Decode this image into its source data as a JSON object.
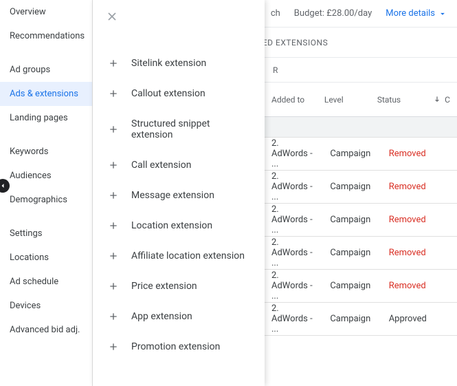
{
  "sidebar": {
    "items": [
      {
        "label": "Overview"
      },
      {
        "label": "Recommendations"
      },
      {
        "label": "Ad groups"
      },
      {
        "label": "Ads & extensions"
      },
      {
        "label": "Landing pages"
      },
      {
        "label": "Keywords"
      },
      {
        "label": "Audiences"
      },
      {
        "label": "Demographics"
      },
      {
        "label": "Settings"
      },
      {
        "label": "Locations"
      },
      {
        "label": "Ad schedule"
      },
      {
        "label": "Devices"
      },
      {
        "label": "Advanced bid adj."
      }
    ]
  },
  "topbar": {
    "search_fragment": "ch",
    "budget_label": "Budget: £28.00/day",
    "more_details": "More details"
  },
  "tabs": {
    "automated": "AUTOMATED EXTENSIONS"
  },
  "table": {
    "filter_fragment": "R",
    "headers": {
      "added_to": "Added to",
      "level": "Level",
      "status": "Status",
      "last": "C"
    },
    "rows": [
      {
        "added_to": "2. AdWords - ...",
        "level": "Campaign",
        "status": "Removed"
      },
      {
        "added_to": "2. AdWords - ...",
        "level": "Campaign",
        "status": "Removed"
      },
      {
        "added_to": "2. AdWords - ...",
        "level": "Campaign",
        "status": "Removed"
      },
      {
        "added_to": "2. AdWords - ...",
        "level": "Campaign",
        "status": "Removed"
      },
      {
        "added_to": "2. AdWords - ...",
        "level": "Campaign",
        "status": "Removed"
      },
      {
        "added_to": "2. AdWords - ...",
        "level": "Campaign",
        "status": "Approved"
      }
    ]
  },
  "popover": {
    "items": [
      {
        "label": "Sitelink extension"
      },
      {
        "label": "Callout extension"
      },
      {
        "label": "Structured snippet extension"
      },
      {
        "label": "Call extension"
      },
      {
        "label": "Message extension"
      },
      {
        "label": "Location extension"
      },
      {
        "label": "Affiliate location extension"
      },
      {
        "label": "Price extension"
      },
      {
        "label": "App extension"
      },
      {
        "label": "Promotion extension"
      }
    ]
  }
}
